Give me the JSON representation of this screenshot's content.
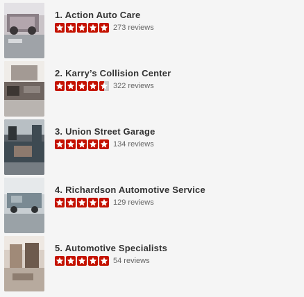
{
  "businesses": [
    {
      "number": "1.",
      "name": "Action Auto Care",
      "rating": 5,
      "reviews": "273 reviews",
      "photo_tone": "#8a7f86"
    },
    {
      "number": "2.",
      "name": "Karry’s Collision Center",
      "rating": 4.5,
      "reviews": "322 reviews",
      "photo_tone": "#6f6560"
    },
    {
      "number": "3.",
      "name": "Union Street Garage",
      "rating": 5,
      "reviews": "134 reviews",
      "photo_tone": "#3e4a52"
    },
    {
      "number": "4.",
      "name": "Richardson Automotive Service",
      "rating": 5,
      "reviews": "129 reviews",
      "photo_tone": "#7a8a93"
    },
    {
      "number": "5.",
      "name": "Automotive Specialists",
      "rating": 5,
      "reviews": "54 reviews",
      "photo_tone": "#a08a78"
    }
  ],
  "colors": {
    "star_fill": "#c41200",
    "star_empty": "#cccccc",
    "title": "#333333",
    "reviews_text": "#666666"
  }
}
